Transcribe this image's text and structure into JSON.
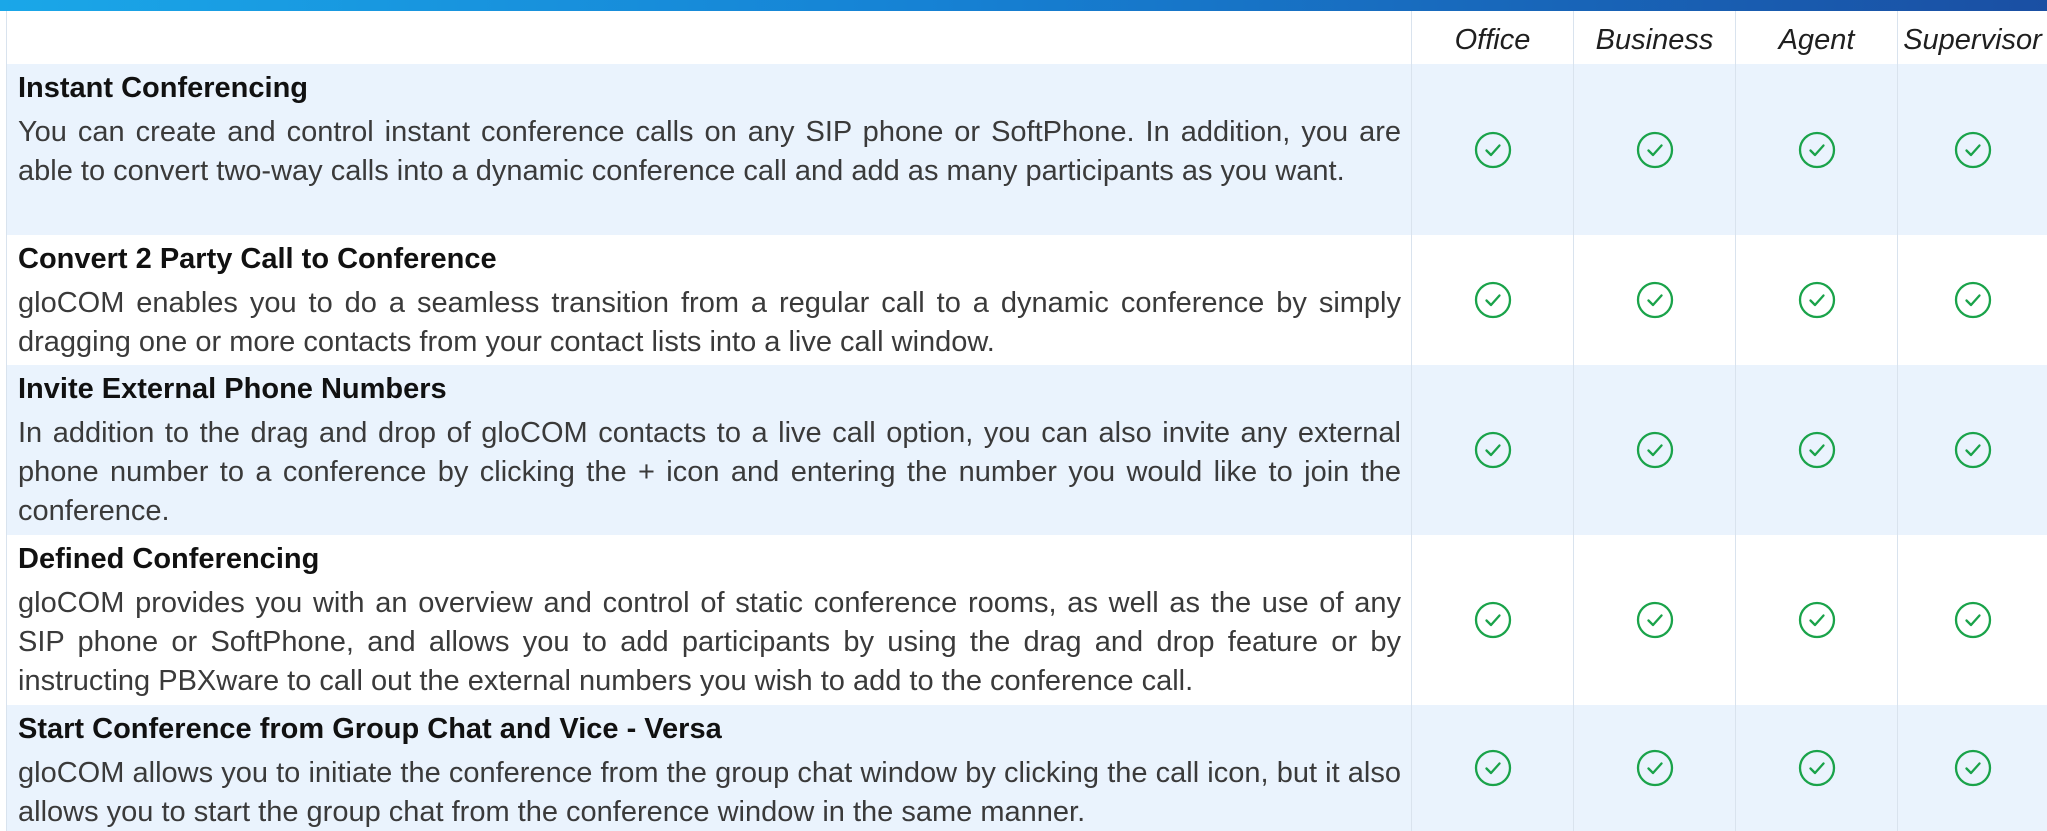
{
  "header": {
    "columns": [
      "Office",
      "Business",
      "Agent",
      "Supervisor"
    ]
  },
  "rows": [
    {
      "title": "Instant Conferencing",
      "description": "You can create and control instant conference calls on any SIP phone or SoftPhone. In addition, you are able to convert two-way calls into a dynamic conference call and add as many participants as you want."
    },
    {
      "title": "Convert 2 Party Call to Conference",
      "description": "gloCOM enables you to do a seamless transition from a regular call to a dynamic conference by simply dragging one or more contacts from your contact lists into a live call window."
    },
    {
      "title": "Invite External Phone Numbers",
      "description": "In addition to the drag and drop of gloCOM contacts to a live call option, you can also invite any external phone number to a conference by clicking the + icon and entering the number you would like to join the conference."
    },
    {
      "title": "Defined Conferencing",
      "description": "gloCOM provides you with an overview and control of static conference rooms, as well as the use of any SIP phone or SoftPhone, and allows you to add participants by using the drag and drop feature or by instructing PBXware to call out the external numbers you wish to add to the conference call."
    },
    {
      "title": "Start Conference from Group Chat and Vice - Versa",
      "description": "gloCOM allows you to initiate the conference from the group chat window by clicking the call icon, but it also allows you to start the group chat from the conference window in the same manner."
    }
  ],
  "icons": {
    "check": "check-circle-icon"
  },
  "colors": {
    "top_bar_start": "#1aa7e8",
    "top_bar_end": "#1a4fa3",
    "row_alt_background": "#eaf3fd",
    "check_color": "#1aa34a",
    "grid_line": "#d9e3ee"
  }
}
